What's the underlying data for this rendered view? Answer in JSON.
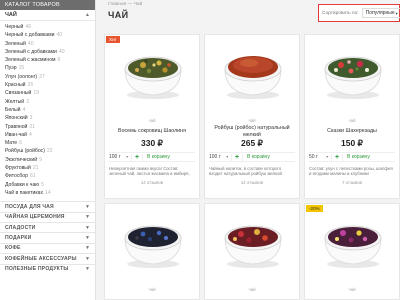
{
  "sidebar": {
    "catalog_header": "КАТАЛОГ ТОВАРОВ",
    "current_category": "ЧАЙ",
    "subcategories": [
      {
        "label": "Черный",
        "count": "46"
      },
      {
        "label": "Черный с добавками",
        "count": "40"
      },
      {
        "label": "Зеленый",
        "count": "40"
      },
      {
        "label": "Зеленый с добавками",
        "count": "40"
      },
      {
        "label": "Зеленый с жасмином",
        "count": "6"
      },
      {
        "label": "Пуэр",
        "count": "15"
      },
      {
        "label": "Улун (оолонг)",
        "count": "27"
      },
      {
        "label": "Красный",
        "count": "26"
      },
      {
        "label": "Связанный",
        "count": "19"
      },
      {
        "label": "Желтый",
        "count": "3"
      },
      {
        "label": "Белый",
        "count": "4"
      },
      {
        "label": "Японский",
        "count": "3"
      },
      {
        "label": "Травяной",
        "count": "21"
      },
      {
        "label": "Иван-чай",
        "count": "4"
      },
      {
        "label": "Мате",
        "count": "6"
      },
      {
        "label": "Ройбуш (ройбос)",
        "count": "22"
      },
      {
        "label": "Экзотический",
        "count": "9"
      },
      {
        "label": "Фруктовый",
        "count": "21"
      },
      {
        "label": "Фитосбор",
        "count": "61"
      },
      {
        "label": "Добавки к чаю",
        "count": "5"
      },
      {
        "label": "Чай в пакетиках",
        "count": "14"
      }
    ],
    "sections": [
      "ПОСУДА ДЛЯ ЧАЯ",
      "ЧАЙНАЯ ЦЕРЕМОНИЯ",
      "СЛАДОСТИ",
      "ПОДАРКИ",
      "КОФЕ",
      "КОФЕЙНЫЕ АКСЕССУАРЫ",
      "ПОЛЕЗНЫЕ ПРОДУКТЫ"
    ]
  },
  "main": {
    "breadcrumb": "Главная  —  Чай",
    "title": "ЧАЙ",
    "sort_label": "Сортировать по:",
    "sort_value": "Популярные"
  },
  "products": [
    {
      "badge": "Хит",
      "category": "чай",
      "name": "Восемь сокровищ Шаолиня",
      "price": "330 ₽",
      "weight": "100 г",
      "availability": "В корзину",
      "description": "Невероятная гамма вкуса! Состав: зеленый чай, листья жасмина и имбиря, сладкий",
      "reviews": "14 отзывов"
    },
    {
      "badge": "",
      "category": "чай",
      "name": "Ройбуш (ройбос) натуральный мелкий",
      "price": "265 ₽",
      "weight": "100 г",
      "availability": "В корзину",
      "description": "Чайный напиток, в составе которого входит натуральный ройбуш мелкой нарезки",
      "reviews": "14 отзывов"
    },
    {
      "badge": "",
      "category": "чай",
      "name": "Сказки Шахерезады",
      "price": "150 ₽",
      "weight": "50 г",
      "availability": "В корзину",
      "description": "Состав: улун с лепестками розы, шалфея и ягодами малины и клубники",
      "reviews": "7 отзывов"
    },
    {
      "badge": "",
      "category": "чай",
      "name": "",
      "price": "",
      "weight": "",
      "availability": "",
      "description": "",
      "reviews": ""
    },
    {
      "badge": "",
      "category": "чай",
      "name": "",
      "price": "",
      "weight": "",
      "availability": "",
      "description": "",
      "reviews": ""
    },
    {
      "badge": "-20%",
      "category": "чай",
      "name": "",
      "price": "",
      "weight": "",
      "availability": "",
      "description": "",
      "reviews": ""
    }
  ],
  "colors": {
    "accent_red": "#e23b3b",
    "available_green": "#2c9a3a",
    "badge_hit": "#e8542e",
    "badge_sale": "#f2c500"
  }
}
